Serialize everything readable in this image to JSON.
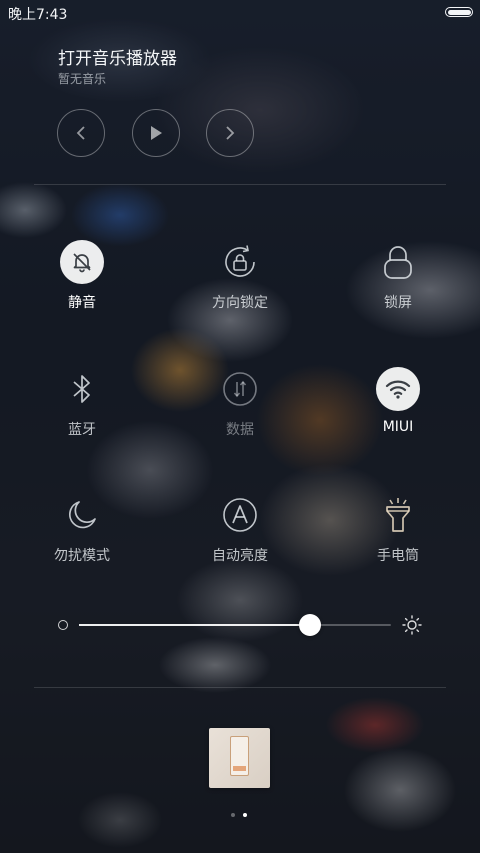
{
  "status_bar": {
    "time": "晚上7:43"
  },
  "music": {
    "title": "打开音乐播放器",
    "subtitle": "暂无音乐",
    "controls": [
      "previous-icon",
      "play-icon",
      "next-icon"
    ]
  },
  "toggles": [
    {
      "label": "静音",
      "icon": "bell-muted-icon",
      "active": true
    },
    {
      "label": "方向锁定",
      "icon": "rotation-lock-icon",
      "active": false
    },
    {
      "label": "锁屏",
      "icon": "lock-icon",
      "active": false
    },
    {
      "label": "蓝牙",
      "icon": "bluetooth-icon",
      "active": false
    },
    {
      "label": "数据",
      "icon": "mobile-data-icon",
      "active": false
    },
    {
      "label": "MIUI",
      "icon": "wifi-icon",
      "active": true
    },
    {
      "label": "勿扰模式",
      "icon": "moon-icon",
      "active": false
    },
    {
      "label": "自动亮度",
      "icon": "auto-brightness-icon",
      "active": false
    },
    {
      "label": "手电筒",
      "icon": "flashlight-icon",
      "active": false
    }
  ],
  "brightness": {
    "level": 0.74
  },
  "pager": {
    "count": 2,
    "current": 1
  },
  "colors": {
    "active_bg": "#ffffff",
    "icon_active": "#3a3f45",
    "icon_inactive": "#e6ebef"
  }
}
